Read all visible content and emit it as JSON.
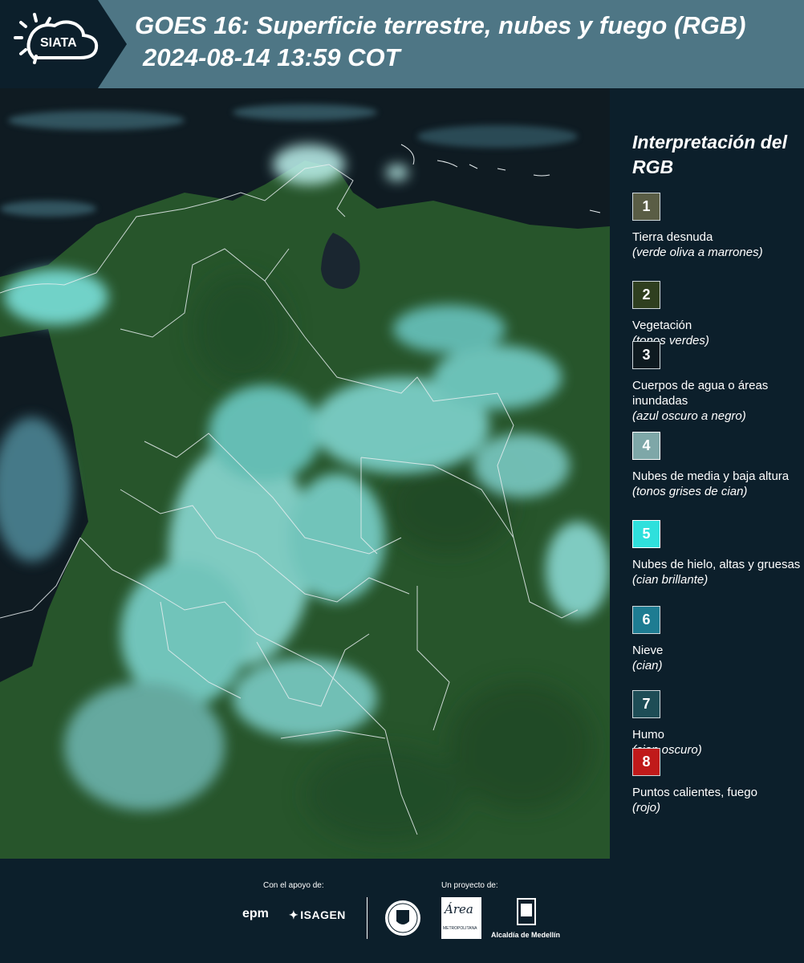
{
  "header": {
    "logo_text": "SIATA",
    "title_line1": "GOES 16: Superficie terrestre, nubes y fuego (RGB)",
    "title_line2": "2024-08-14 13:59 COT"
  },
  "legend": {
    "title": "Interpretación del RGB",
    "items": [
      {
        "number": "1",
        "label": "Tierra desnuda",
        "desc": "(verde oliva a marrones)",
        "color": "#5a5d45"
      },
      {
        "number": "2",
        "label": "Vegetación",
        "desc": "(tonos verdes)",
        "color": "#2f3f1f"
      },
      {
        "number": "3",
        "label": "Cuerpos de agua o áreas inundadas",
        "desc": "(azul oscuro a negro)",
        "color": "#0e1a20"
      },
      {
        "number": "4",
        "label": "Nubes de media y baja altura",
        "desc": "(tonos grises de cian)",
        "color": "#7ea7a8"
      },
      {
        "number": "5",
        "label": "Nubes de hielo, altas y gruesas",
        "desc": "(cian brillante)",
        "color": "#2fe0dc"
      },
      {
        "number": "6",
        "label": "Nieve",
        "desc": "(cian)",
        "color": "#1e7c92"
      },
      {
        "number": "7",
        "label": "Humo",
        "desc": "(cian oscuro)",
        "color": "#1e4d56"
      },
      {
        "number": "8",
        "label": "Puntos calientes, fuego",
        "desc": "(rojo)",
        "color": "#c01a1a"
      }
    ]
  },
  "footer": {
    "support_label": "Con el apoyo de:",
    "project_label": "Un proyecto de:",
    "epm": "epm",
    "isagen": "ISAGEN",
    "area_word": "Área",
    "area_sub": "METROPOLITANA",
    "alcaldia": "Alcaldía de Medellín"
  }
}
